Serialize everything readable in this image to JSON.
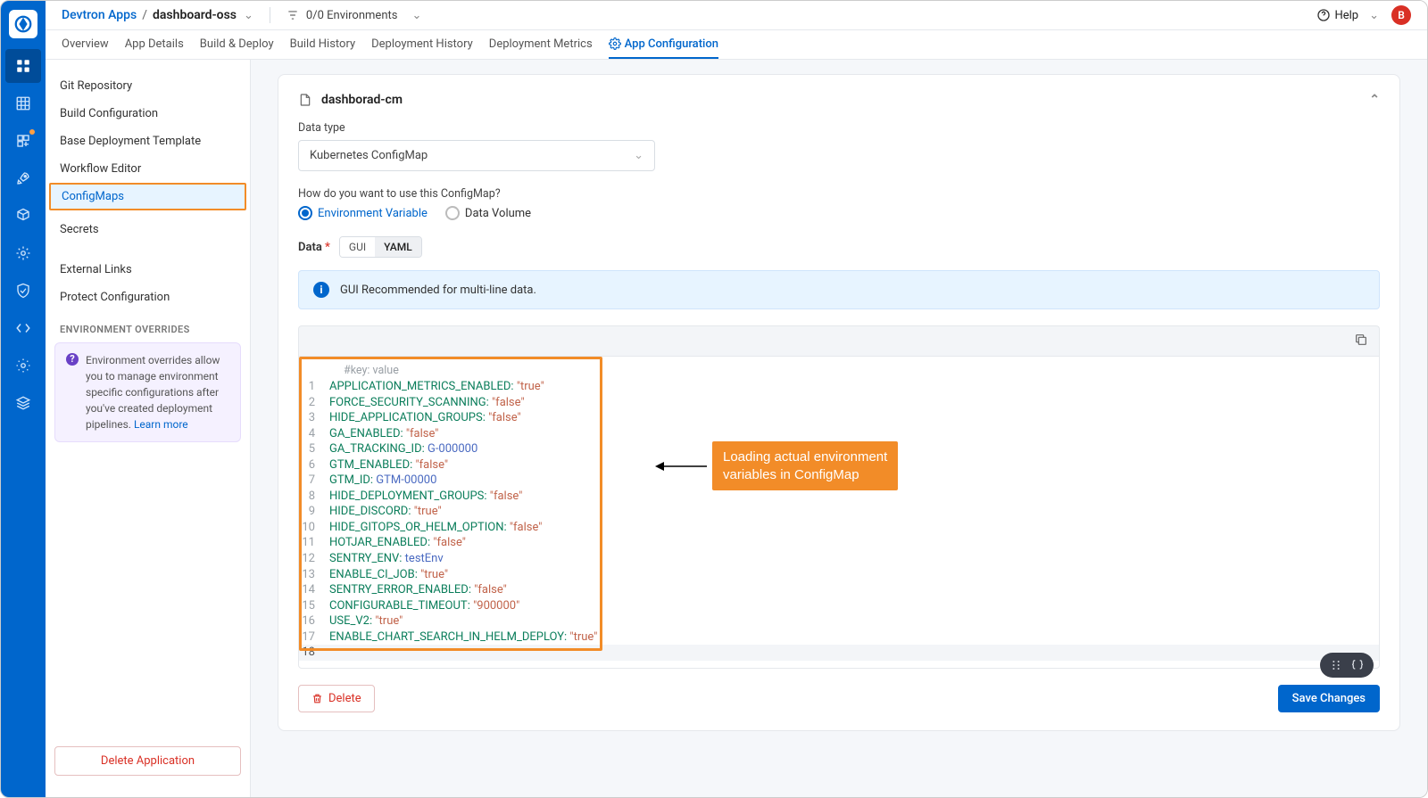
{
  "breadcrumb": {
    "parent": "Devtron Apps",
    "current": "dashboard-oss"
  },
  "env_selector": "0/0 Environments",
  "help_label": "Help",
  "avatar_letter": "B",
  "tabs": [
    "Overview",
    "App Details",
    "Build & Deploy",
    "Build History",
    "Deployment History",
    "Deployment Metrics",
    "App Configuration"
  ],
  "sidebar": {
    "items": [
      "Git Repository",
      "Build Configuration",
      "Base Deployment Template",
      "Workflow Editor",
      "ConfigMaps",
      "Secrets",
      "External Links",
      "Protect Configuration"
    ],
    "active_index": 4,
    "section_head": "ENVIRONMENT OVERRIDES",
    "info": "Environment overrides allow you to manage environment specific configurations after you've created deployment pipelines.",
    "learn_more": "Learn more",
    "delete_app": "Delete Application"
  },
  "cm": {
    "title": "dashborad-cm",
    "datatype_label": "Data type",
    "datatype_value": "Kubernetes ConfigMap",
    "usage_label": "How do you want to use this ConfigMap?",
    "radio_env": "Environment Variable",
    "radio_vol": "Data Volume",
    "data_label": "Data",
    "gui_btn": "GUI",
    "yaml_btn": "YAML",
    "banner": "GUI Recommended for multi-line data.",
    "comment": "#key: value",
    "lines": [
      {
        "key": "APPLICATION_METRICS_ENABLED",
        "val": "\"true\"",
        "str": true
      },
      {
        "key": "FORCE_SECURITY_SCANNING",
        "val": "\"false\"",
        "str": true
      },
      {
        "key": "HIDE_APPLICATION_GROUPS",
        "val": "\"false\"",
        "str": true
      },
      {
        "key": "GA_ENABLED",
        "val": "\"false\"",
        "str": true
      },
      {
        "key": "GA_TRACKING_ID",
        "val": "G-000000",
        "str": false
      },
      {
        "key": "GTM_ENABLED",
        "val": "\"false\"",
        "str": true
      },
      {
        "key": "GTM_ID",
        "val": "GTM-00000",
        "str": false
      },
      {
        "key": "HIDE_DEPLOYMENT_GROUPS",
        "val": "\"false\"",
        "str": true
      },
      {
        "key": "HIDE_DISCORD",
        "val": "\"true\"",
        "str": true
      },
      {
        "key": "HIDE_GITOPS_OR_HELM_OPTION",
        "val": "\"false\"",
        "str": true
      },
      {
        "key": "HOTJAR_ENABLED",
        "val": "\"false\"",
        "str": true
      },
      {
        "key": "SENTRY_ENV",
        "val": "testEnv",
        "str": false
      },
      {
        "key": "ENABLE_CI_JOB",
        "val": "\"true\"",
        "str": true
      },
      {
        "key": "SENTRY_ERROR_ENABLED",
        "val": "\"false\"",
        "str": true
      },
      {
        "key": "CONFIGURABLE_TIMEOUT",
        "val": "\"900000\"",
        "str": true
      },
      {
        "key": "USE_V2",
        "val": "\"true\"",
        "str": true
      },
      {
        "key": "ENABLE_CHART_SEARCH_IN_HELM_DEPLOY",
        "val": "\"true\"",
        "str": true
      }
    ],
    "delete_btn": "Delete",
    "save_btn": "Save Changes"
  },
  "callout": "Loading actual environment\nvariables in ConfigMap"
}
